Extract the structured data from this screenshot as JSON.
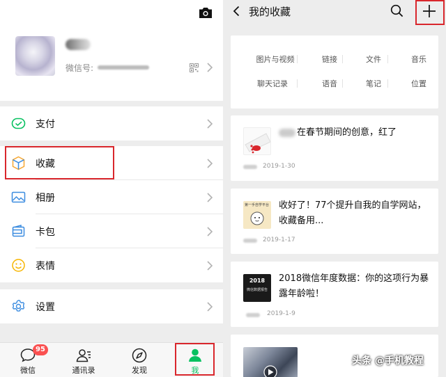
{
  "left": {
    "profile": {
      "wechat_id_label": "微信号:"
    },
    "menu": {
      "pay": "支付",
      "favorites": "收藏",
      "album": "相册",
      "cards": "卡包",
      "stickers": "表情",
      "settings": "设置"
    },
    "tabbar": {
      "chats": "微信",
      "chats_badge": "95",
      "contacts": "通讯录",
      "discover": "发现",
      "me": "我"
    }
  },
  "right": {
    "title": "我的收藏",
    "categories": [
      "图片与视频",
      "链接",
      "文件",
      "音乐",
      "聊天记录",
      "语音",
      "笔记",
      "位置"
    ],
    "items": [
      {
        "title": "在春节期间的创意，红了",
        "date": "2019-1-30"
      },
      {
        "title": "收好了！77个提升自我的自学网站，收藏备用...",
        "date": "2019-1-17",
        "thumb_text": "第一手自学平台"
      },
      {
        "title": "2018微信年度数据：你的这项行为暴露年龄啦！",
        "date": "2019-1-9",
        "thumb_text_1": "2018",
        "thumb_text_2": "微信数据报告"
      }
    ]
  },
  "watermark": "头条 @手机教程",
  "colors": {
    "accent_green": "#07c160",
    "highlight_red": "#d9262c",
    "badge_red": "#fa5151"
  }
}
